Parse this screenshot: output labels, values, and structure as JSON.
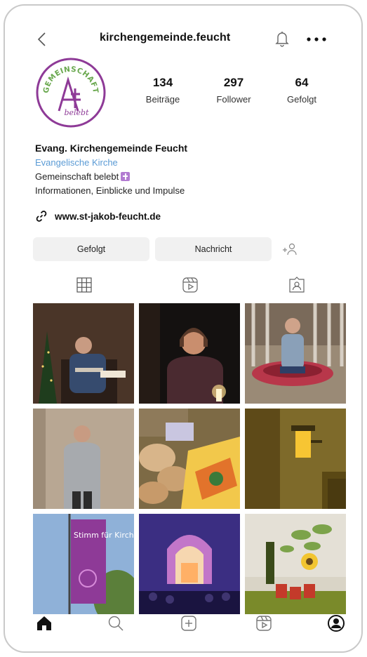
{
  "header": {
    "username": "kirchengemeinde.feucht"
  },
  "profile": {
    "avatar_text_top": "GEMEINSCHAFT",
    "avatar_text_bottom": "belebt",
    "stats": [
      {
        "value": "134",
        "label": "Beiträge"
      },
      {
        "value": "297",
        "label": "Follower"
      },
      {
        "value": "64",
        "label": "Gefolgt"
      }
    ],
    "name": "Evang. Kirchengemeinde Feucht",
    "category": "Evangelische Kirche",
    "bio_line1": "Gemeinschaft belebt",
    "bio_line2": "Informationen, Einblicke und Impulse",
    "website": "www.st-jakob-feucht.de"
  },
  "actions": {
    "following_label": "Gefolgt",
    "message_label": "Nachricht"
  },
  "posts": {
    "banner_text": "Stimm für Kirche"
  },
  "colors": {
    "accent_purple": "#8e3a97",
    "link_blue": "#5b9bd5",
    "button_bg": "#f1f1f1"
  }
}
